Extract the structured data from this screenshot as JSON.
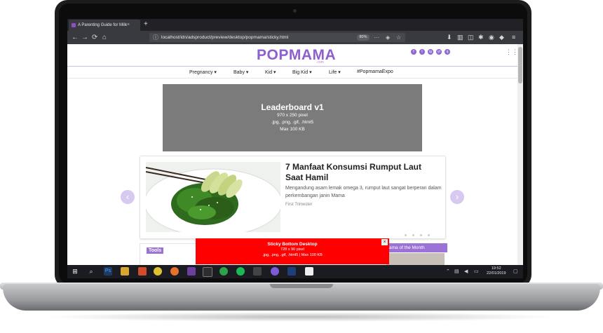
{
  "browser": {
    "tab_title": "A Parenting Guide for Millennial Mamas",
    "tab_close": "×",
    "new_tab": "+",
    "back": "←",
    "forward": "→",
    "reload": "⟳",
    "home": "⌂",
    "url": "localhost/idn/adsproduct/preview/desktop/popmama/sticky.html",
    "zoom": "80%"
  },
  "site": {
    "logo": "POPMAMA",
    "logo_sub": ".com",
    "social": [
      "f",
      "t",
      "ig",
      "yt",
      "q"
    ],
    "menu": [
      "Pregnancy ▾",
      "Baby ▾",
      "Kid ▾",
      "Big Kid ▾",
      "Life ▾",
      "#PopmamaExpo"
    ]
  },
  "leaderboard": {
    "title": "Leaderboard v1",
    "size": "970 x 250 pixel",
    "formats": ".jpg, .png, .gif, .html5",
    "max": "Max 100 KB"
  },
  "article": {
    "title": "7 Manfaat Konsumsi Rumput Laut Saat Hamil",
    "desc": "Mengandung asam lemak omega 3, rumput laut sangat berperan dalam perkembangan janin Mama",
    "category": "First Trimester"
  },
  "carousel": {
    "prev": "‹",
    "next": "›"
  },
  "widgets": {
    "tools": "Tools",
    "mama_of_month": "ama of the Month"
  },
  "sticky_ad": {
    "title": "Sticky Bottom Desktop",
    "size": "728 x 90 pixel",
    "formats": ".jpg, .png, .gif, .html5 | Max 100 KB",
    "close": "×"
  },
  "taskbar": {
    "time": "19:52",
    "date": "22/01/2019"
  },
  "colors": {
    "brand": "#8e5fd0",
    "sticky": "#ff0000",
    "leaderboard": "#7b7b7b"
  }
}
